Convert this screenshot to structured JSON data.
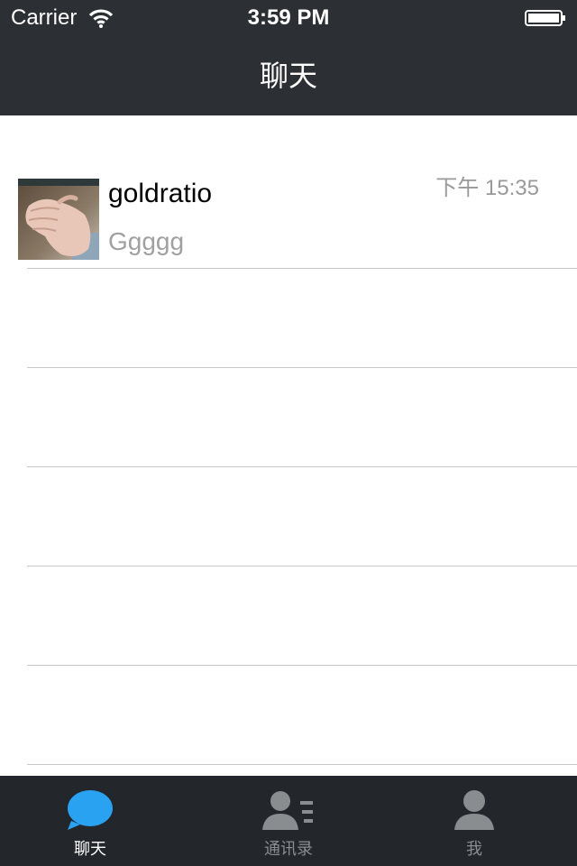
{
  "status_bar": {
    "carrier": "Carrier",
    "time": "3:59 PM"
  },
  "nav": {
    "title": "聊天"
  },
  "chats": [
    {
      "name": "goldratio",
      "time": "下午 15:35",
      "preview": "Ggggg",
      "avatar_icon": "hand-photo-avatar"
    }
  ],
  "tabbar": {
    "tabs": [
      {
        "label": "聊天",
        "icon": "chat-bubble-icon",
        "active": true
      },
      {
        "label": "通讯录",
        "icon": "contacts-icon",
        "active": false
      },
      {
        "label": "我",
        "icon": "person-icon",
        "active": false
      }
    ]
  },
  "colors": {
    "topbar_bg": "#2c2f33",
    "tabbar_bg": "#23272c",
    "active_tab": "#2aa2f2",
    "inactive_tab": "#8a8d90",
    "separator": "#c8c8c8"
  }
}
